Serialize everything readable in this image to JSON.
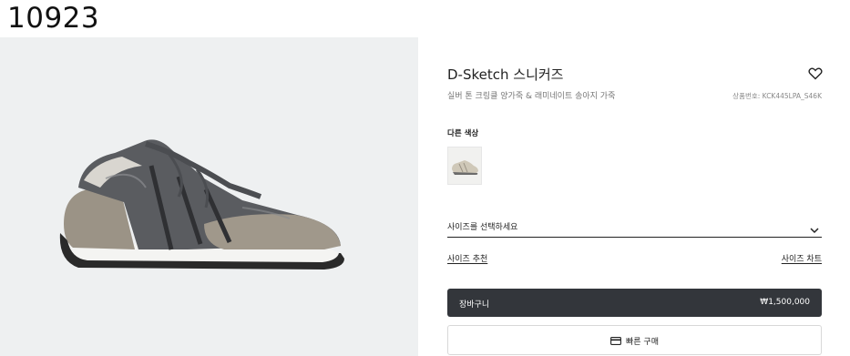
{
  "page_id": "10923",
  "product": {
    "title": "D-Sketch 스니커즈",
    "subtitle": "실버 톤 크링클 양가죽 & 래미네이트 송아지 가죽",
    "sku": "상품번호: KCK445LPA_S46K"
  },
  "colors": {
    "label": "다른 색상"
  },
  "size": {
    "select_label": "사이즈를 선택하세요",
    "recommend_label": "사이즈 추천",
    "chart_label": "사이즈 차트"
  },
  "actions": {
    "cart_label": "장바구니",
    "cart_price": "₩1,500,000",
    "quick_buy_label": "빠른 구매"
  },
  "icons": {
    "wishlist": "heart-icon",
    "dropdown": "chevron-down-icon",
    "quick_buy": "credit-card-icon"
  }
}
